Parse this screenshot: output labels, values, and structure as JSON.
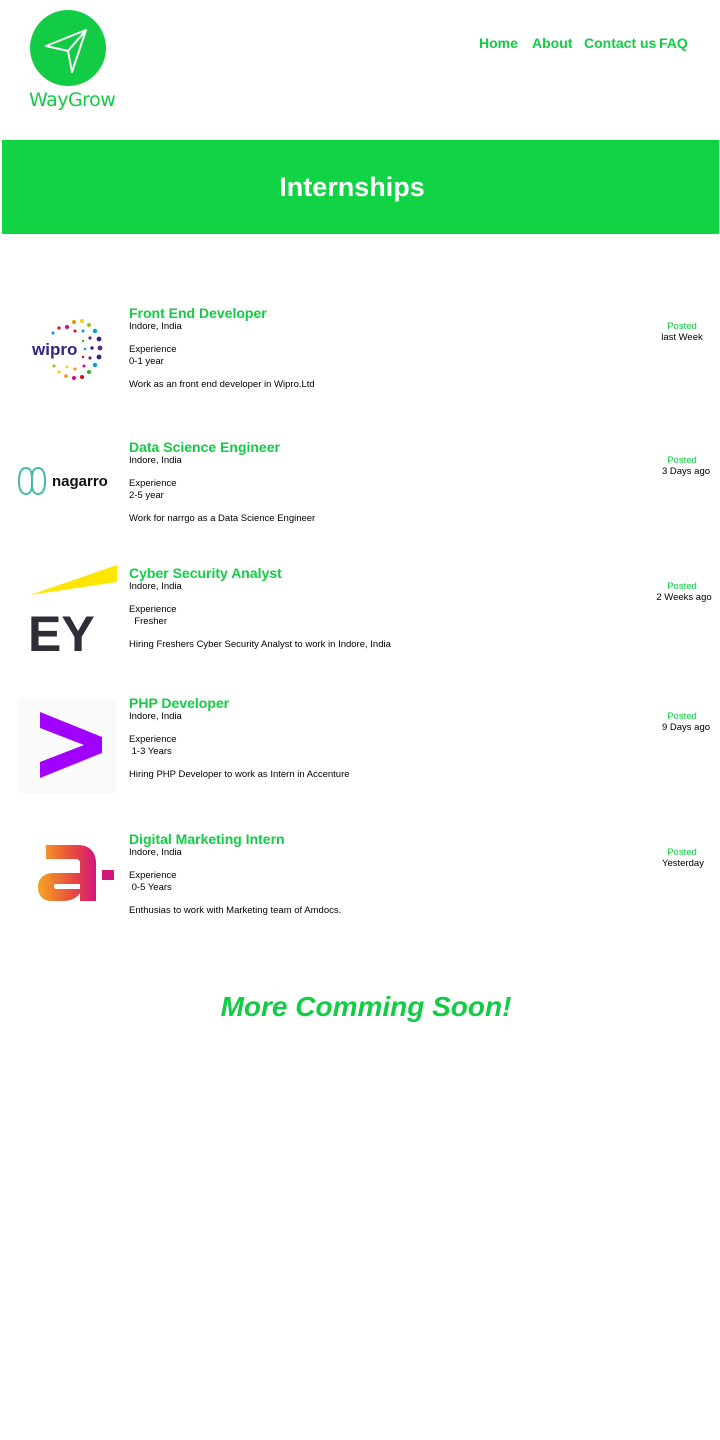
{
  "brand": {
    "name": "WayGrow",
    "logo_icon": "paper-plane-icon",
    "color": "#11cc44"
  },
  "nav": {
    "items": [
      {
        "label": "Home"
      },
      {
        "label": "About"
      },
      {
        "label": "Contact us"
      },
      {
        "label": "FAQ"
      }
    ]
  },
  "banner": {
    "title": "Internships",
    "color": "#11d445"
  },
  "jobs": [
    {
      "company_logo": "wipro-logo",
      "title": "Front End Developer",
      "location": "Indore, India",
      "experience_label": "Experience",
      "experience": "0-1 year",
      "description": "Work as an front end developer in Wipro.Ltd",
      "posted_label": "Posted",
      "posted": "last Week"
    },
    {
      "company_logo": "nagarro-logo",
      "title": "Data Science Engineer",
      "location": "Indore, India",
      "experience_label": "Experience",
      "experience": "2-5 year",
      "description": "Work for narrgo as a Data Science Engineer",
      "posted_label": "Posted",
      "posted": "3 Days ago"
    },
    {
      "company_logo": "ey-logo",
      "title": "Cyber Security Analyst",
      "location": "Indore, India",
      "experience_label": "Experience",
      "experience": "  Fresher",
      "description": "Hiring Freshers Cyber Security Analyst to work in Indore, India",
      "posted_label": "Posted",
      "posted": "2 Weeks ago"
    },
    {
      "company_logo": "accenture-logo",
      "title": "PHP Developer",
      "location": "Indore, India",
      "experience_label": "Experience",
      "experience": " 1-3 Years",
      "description": "Hiring PHP Developer to work as Intern in Accenture",
      "posted_label": "Posted",
      "posted": "9 Days ago"
    },
    {
      "company_logo": "amdocs-logo",
      "title": "Digital Marketing Intern",
      "location": "Indore, India",
      "experience_label": "Experience",
      "experience": " 0-5 Years",
      "description": "Enthusias to work with Marketing team of Amdocs.",
      "posted_label": "Posted",
      "posted": "Yesterday"
    }
  ],
  "footer": {
    "more_text": "More Comming Soon!"
  }
}
